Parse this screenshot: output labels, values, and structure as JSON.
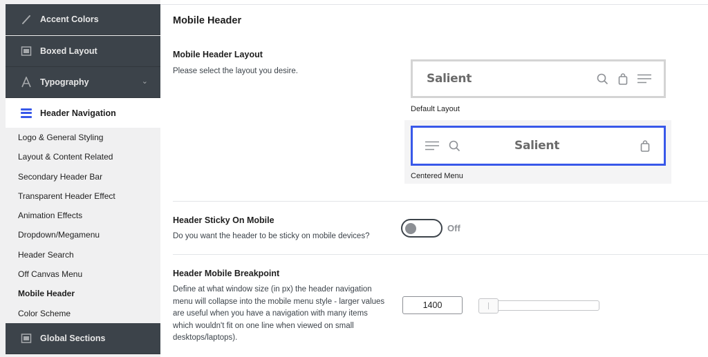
{
  "sidebar": {
    "items_top": [
      {
        "label": "Accent Colors",
        "icon": "brush-icon"
      },
      {
        "label": "Boxed Layout",
        "icon": "layout-icon"
      },
      {
        "label": "Typography",
        "icon": "typography-icon"
      }
    ],
    "active": {
      "label": "Header Navigation",
      "icon": "menu-icon"
    },
    "sub_items": [
      "Logo & General Styling",
      "Layout & Content Related",
      "Secondary Header Bar",
      "Transparent Header Effect",
      "Animation Effects",
      "Dropdown/Megamenu",
      "Header Search",
      "Off Canvas Menu",
      "Mobile Header",
      "Color Scheme"
    ],
    "current_sub": "Mobile Header",
    "bottom": {
      "label": "Global Sections",
      "icon": "layout-icon"
    }
  },
  "main": {
    "section_title": "Mobile Header",
    "layout": {
      "title": "Mobile Header Layout",
      "description": "Please select the layout you desire.",
      "options": [
        {
          "label": "Default Layout",
          "logo": "Salient",
          "selected": false
        },
        {
          "label": "Centered Menu",
          "logo": "Salient",
          "selected": true
        }
      ]
    },
    "sticky": {
      "title": "Header Sticky On Mobile",
      "description": "Do you want the header to be sticky on mobile devices?",
      "state_label": "Off"
    },
    "breakpoint": {
      "title": "Header Mobile Breakpoint",
      "description_lines": [
        "Define at what window size (in px) the header navigation",
        "menu will collapse into the mobile menu style - larger values",
        "are useful when you have a navigation with many items",
        "which wouldn't fit on one line when viewed on small",
        "desktops/laptops)."
      ],
      "value": "1400"
    }
  },
  "colors": {
    "accent": "#3858e9",
    "sidebar_dark": "#3c434a",
    "sidebar_bg": "#f0f0f1"
  }
}
